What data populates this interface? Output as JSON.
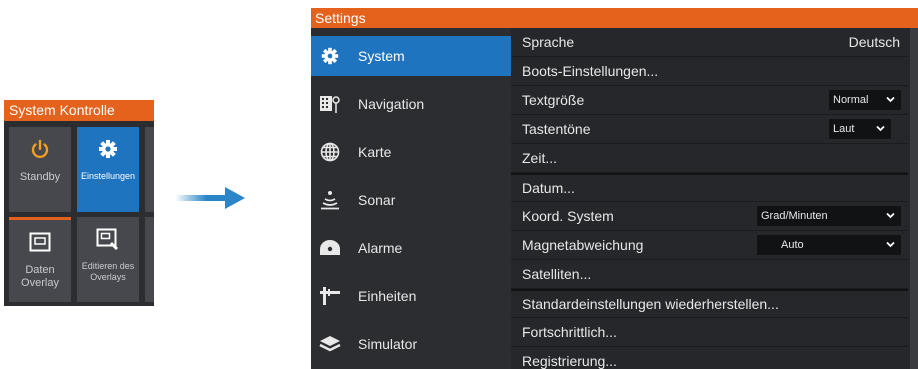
{
  "system_panel": {
    "title": "System Kontrolle",
    "tiles": [
      {
        "label": "Standby",
        "icon": "power-icon"
      },
      {
        "label": "Einstellungen",
        "icon": "gear-icon",
        "selected": true
      },
      {
        "label": "Daten Overlay",
        "icon": "overlay-icon"
      },
      {
        "label": "Editieren des Overlays",
        "icon": "edit-overlay-icon"
      }
    ]
  },
  "settings": {
    "title": "Settings",
    "nav": [
      {
        "label": "System",
        "icon": "gear-icon",
        "selected": true
      },
      {
        "label": "Navigation",
        "icon": "navigation-icon"
      },
      {
        "label": "Karte",
        "icon": "globe-icon"
      },
      {
        "label": "Sonar",
        "icon": "sonar-icon"
      },
      {
        "label": "Alarme",
        "icon": "alarm-icon"
      },
      {
        "label": "Einheiten",
        "icon": "units-icon"
      },
      {
        "label": "Simulator",
        "icon": "layers-icon"
      }
    ],
    "rows": {
      "sprache": {
        "label": "Sprache",
        "value": "Deutsch"
      },
      "boots": {
        "label": "Boots-Einstellungen..."
      },
      "textgroesse": {
        "label": "Textgröße",
        "value": "Normal"
      },
      "tastentoene": {
        "label": "Tastentöne",
        "value": "Laut"
      },
      "zeit": {
        "label": "Zeit..."
      },
      "datum": {
        "label": "Datum..."
      },
      "koord": {
        "label": "Koord. System",
        "value": "Grad/Minuten"
      },
      "magnet": {
        "label": "Magnetabweichung",
        "value": "Auto"
      },
      "satelliten": {
        "label": "Satelliten..."
      },
      "standard": {
        "label": "Standardeinstellungen wiederherstellen..."
      },
      "fortschritt": {
        "label": "Fortschrittlich..."
      },
      "registrierung": {
        "label": "Registrierung..."
      }
    }
  },
  "colors": {
    "accent": "#e4621c",
    "selected": "#1f74bf",
    "arrow": "#2a86c9"
  }
}
